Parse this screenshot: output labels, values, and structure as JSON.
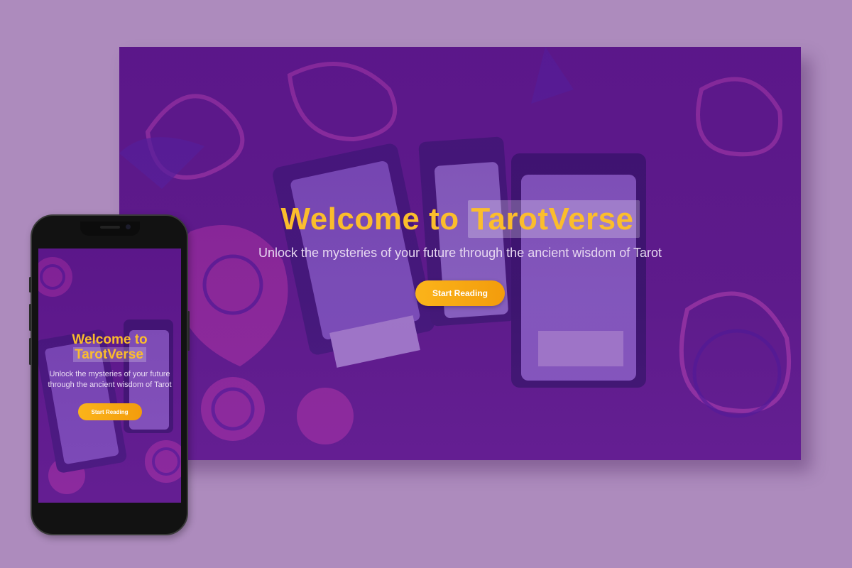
{
  "colors": {
    "page_background": "#ad8bbd",
    "overlay_purple": "#5c1096",
    "title_gold": "#fbbd2c",
    "button_orange": "#f5a511",
    "subtitle": "#e7d8f1"
  },
  "desktop": {
    "title_prefix": "Welcome to",
    "title_highlight": "TarotVerse",
    "subtitle": "Unlock the mysteries of your future through the ancient wisdom of Tarot",
    "cta_label": "Start Reading"
  },
  "mobile": {
    "title_line1": "Welcome to",
    "title_line2": "TarotVerse",
    "subtitle": "Unlock the mysteries of your future through the ancient wisdom of Tarot",
    "cta_label": "Start Reading"
  }
}
